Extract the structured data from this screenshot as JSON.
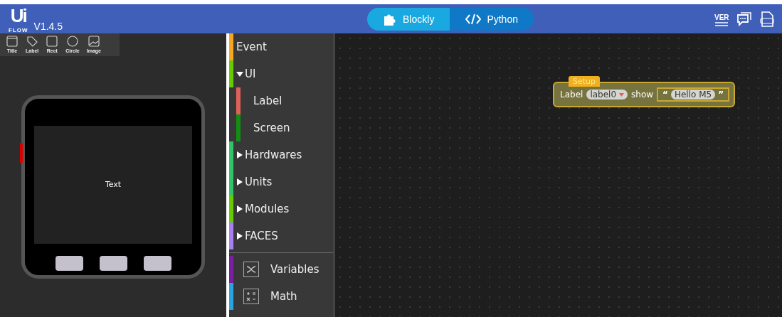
{
  "header": {
    "logo": "Ui",
    "logo_sub": "FLOW",
    "version": "V1.4.5",
    "modes": [
      {
        "label": "Blockly",
        "kind": "blocks",
        "selected": true
      },
      {
        "label": "Python",
        "kind": "code",
        "selected": false
      }
    ],
    "tools": [
      {
        "kind": "version",
        "text": "VER"
      },
      {
        "kind": "chat"
      },
      {
        "kind": "doc"
      }
    ]
  },
  "widgets": [
    {
      "label": "Title",
      "kind": "title"
    },
    {
      "label": "Label",
      "kind": "label"
    },
    {
      "label": "Rect",
      "kind": "rect"
    },
    {
      "label": "Circle",
      "kind": "circle"
    },
    {
      "label": "Image",
      "kind": "image"
    }
  ],
  "device": {
    "screen_text": "Text"
  },
  "categories": [
    {
      "label": "Event",
      "color": "#f5a623",
      "kind": "item"
    },
    {
      "label": "UI",
      "color": "#66cc00",
      "kind": "group",
      "expanded": true,
      "children": [
        {
          "label": "Label",
          "color": "#e0605a"
        },
        {
          "label": "Screen",
          "color": "#109010"
        }
      ]
    },
    {
      "label": "Hardwares",
      "color": "#33c46a",
      "kind": "group",
      "expanded": false
    },
    {
      "label": "Units",
      "color": "#33c46a",
      "kind": "group",
      "expanded": false
    },
    {
      "label": "Modules",
      "color": "#66cc00",
      "kind": "group",
      "expanded": false
    },
    {
      "label": "FACES",
      "color": "#a87ff0",
      "kind": "group",
      "expanded": false
    }
  ],
  "builtins": [
    {
      "label": "Variables",
      "kind": "variables",
      "color": "#7a1fa2"
    },
    {
      "label": "Math",
      "kind": "math",
      "color": "#2ba3e0"
    }
  ],
  "block": {
    "hat": "Setup",
    "prefix": "Label",
    "dropdown": "label0",
    "verb": "show",
    "quote_open": "“",
    "string": "Hello M5",
    "quote_close": "”"
  }
}
